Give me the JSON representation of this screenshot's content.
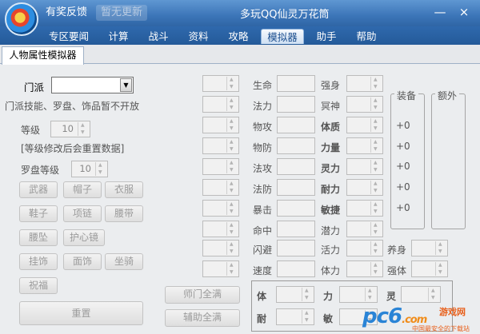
{
  "titlebar": {
    "feedback": "有奖反馈",
    "no_update": "暂无更新",
    "app_title": "多玩QQ仙灵万花筒",
    "minimize": "—",
    "close": "×"
  },
  "nav": {
    "items": [
      {
        "label": "专区要闻"
      },
      {
        "label": "计算"
      },
      {
        "label": "战斗"
      },
      {
        "label": "资料"
      },
      {
        "label": "攻略"
      },
      {
        "label": "模拟器"
      },
      {
        "label": "助手"
      },
      {
        "label": "帮助"
      }
    ],
    "selected_index": 5
  },
  "subtab": {
    "label": "人物属性模拟器"
  },
  "left": {
    "faction_label": "门派",
    "faction_value": "",
    "notice": "门派技能、罗盘、饰品暂不开放",
    "level_label": "等级",
    "level_value": "10",
    "level_note": "[等级修改后会重置数据]",
    "compass_label": "罗盘等级",
    "compass_value": "10",
    "equip_buttons": [
      "武器",
      "帽子",
      "衣服",
      "鞋子",
      "项链",
      "腰带",
      "腰坠",
      "护心镜",
      "挂饰",
      "面饰",
      "坐骑",
      "祝福"
    ],
    "reset": "重置"
  },
  "middle": {
    "stats": [
      "生命",
      "法力",
      "物攻",
      "物防",
      "法攻",
      "法防",
      "暴击",
      "命中",
      "闪避",
      "速度"
    ]
  },
  "right": {
    "attrs": [
      {
        "label": "强身",
        "bold": false
      },
      {
        "label": "冥神",
        "bold": false
      },
      {
        "label": "体质",
        "bold": true
      },
      {
        "label": "力量",
        "bold": true
      },
      {
        "label": "灵力",
        "bold": true
      },
      {
        "label": "耐力",
        "bold": true
      },
      {
        "label": "敏捷",
        "bold": true
      },
      {
        "label": "潜力",
        "bold": false
      },
      {
        "label": "活力",
        "bold": false
      },
      {
        "label": "体力",
        "bold": false
      }
    ],
    "extra": [
      {
        "label": "养身"
      },
      {
        "label": "强体"
      }
    ],
    "equip_title": "装备",
    "extra_title": "额外",
    "equip_values": [
      "+0",
      "+0",
      "+0",
      "+0",
      "+0"
    ]
  },
  "bottom": {
    "master_full": "师门全满",
    "assist_full": "辅助全满",
    "stat_labels": [
      "体",
      "力",
      "灵",
      "耐",
      "敏"
    ]
  },
  "watermark": {
    "logo": "pc6",
    "logo_suffix": ".com",
    "cn": "游戏网",
    "sub": "中国最安全的下载站"
  }
}
